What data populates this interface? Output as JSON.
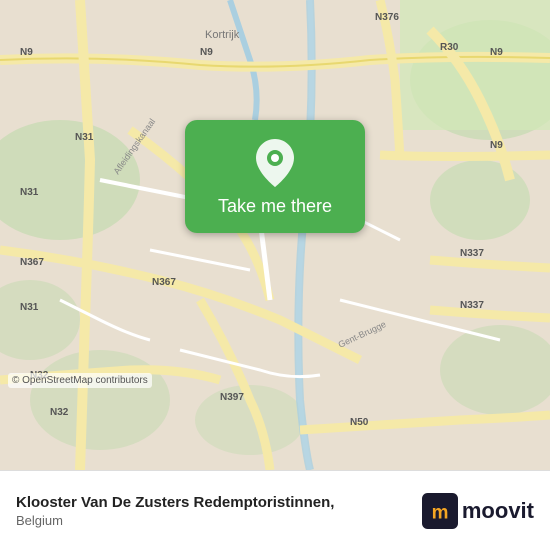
{
  "map": {
    "attribution": "© OpenStreetMap contributors",
    "center_lat": 50.83,
    "center_lon": 3.27,
    "zoom": 12
  },
  "cta": {
    "label": "Take me there",
    "icon": "location-pin"
  },
  "place": {
    "name": "Klooster Van De Zusters Redemptoristinnen,",
    "country": "Belgium"
  },
  "branding": {
    "logo_text": "moovit",
    "logo_color": "#1a1a2e",
    "accent_color": "#f5a623"
  },
  "colors": {
    "map_bg": "#e8dfd0",
    "green_area": "#c8dbb4",
    "road_main": "#f5e9a8",
    "road_secondary": "#ffffff",
    "water": "#aacfe0",
    "cta_green": "#4caf50"
  }
}
